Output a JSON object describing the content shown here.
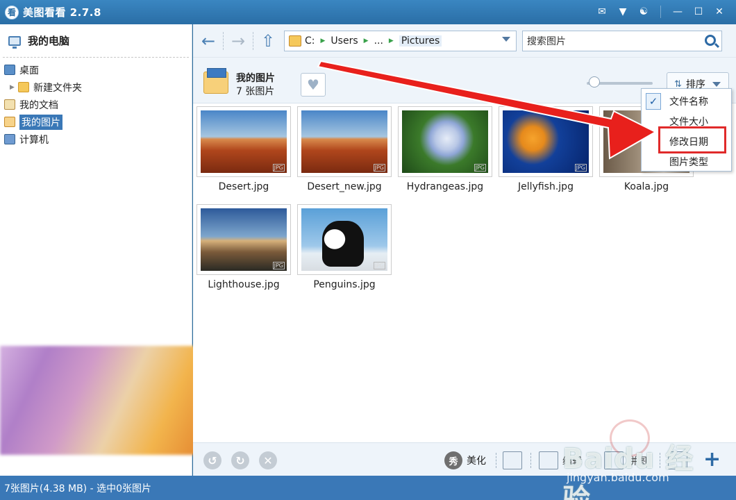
{
  "app": {
    "logo_char": "看",
    "title": "美图看看 2.7.8"
  },
  "titlebar": {
    "icons": [
      "chat-icon",
      "menu-icon",
      "skin-icon",
      "minimize-icon",
      "maximize-icon",
      "close-icon"
    ]
  },
  "sidebar": {
    "header": "我的电脑",
    "items": [
      {
        "label": "桌面",
        "icon": "desktop-icon"
      },
      {
        "label": "新建文件夹",
        "icon": "folder-icon"
      },
      {
        "label": "我的文档",
        "icon": "documents-icon"
      },
      {
        "label": "我的图片",
        "icon": "pictures-icon",
        "selected": true
      },
      {
        "label": "计算机",
        "icon": "computer-icon"
      }
    ]
  },
  "toolbar": {
    "address": {
      "drive": "C:",
      "crumbs": [
        "Users",
        "...",
        "Pictures"
      ]
    },
    "search": {
      "placeholder": "搜索图片"
    }
  },
  "folder": {
    "name": "我的图片",
    "count": "7 张图片"
  },
  "sort": {
    "label": "排序",
    "options": [
      {
        "label": "文件名称",
        "checked": true
      },
      {
        "label": "文件大小"
      },
      {
        "label": "修改日期",
        "highlighted": true
      },
      {
        "label": "图片类型"
      }
    ]
  },
  "thumbnails": [
    {
      "name": "Desert.jpg",
      "style": "desert"
    },
    {
      "name": "Desert_new.jpg",
      "style": "desert"
    },
    {
      "name": "Hydrangeas.jpg",
      "style": "hydr"
    },
    {
      "name": "Jellyfish.jpg",
      "style": "jelly"
    },
    {
      "name": "Koala.jpg",
      "style": "koala"
    },
    {
      "name": "Lighthouse.jpg",
      "style": "light"
    },
    {
      "name": "Penguins.jpg",
      "style": "peng"
    }
  ],
  "thumb_badge": "JPG",
  "bottombar": {
    "beautify_char": "秀",
    "beautify_label": "美化",
    "edit_label": "编辑",
    "puzzle_label": "拼图"
  },
  "status": "7张图片(4.38 MB) - 选中0张图片",
  "watermark": {
    "main": "Baidu 经验",
    "sub": "jingyan.baidu.com"
  },
  "colors": {
    "accent": "#3a78b7",
    "highlight_box": "#e02a2a",
    "arrow": "#e8201c"
  }
}
